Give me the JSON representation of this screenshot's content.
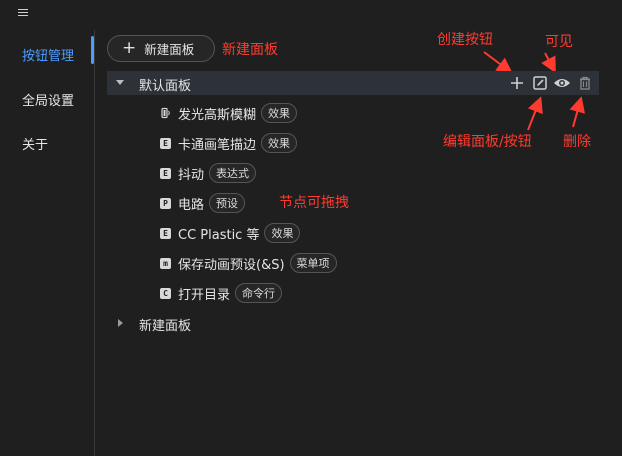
{
  "sidebar": {
    "items": [
      {
        "label": "按钮管理",
        "active": true
      },
      {
        "label": "全局设置",
        "active": false
      },
      {
        "label": "关于",
        "active": false
      }
    ]
  },
  "toolbar": {
    "new_panel_button": "新建面板"
  },
  "panels": [
    {
      "title": "默认面板",
      "expanded": true,
      "items": [
        {
          "icon": "battery-icon",
          "name": "发光高斯模糊",
          "tag": "效果"
        },
        {
          "icon": "E",
          "name": "卡通画笔描边",
          "tag": "效果"
        },
        {
          "icon": "E",
          "name": "抖动",
          "tag": "表达式"
        },
        {
          "icon": "P",
          "name": "电路",
          "tag": "预设"
        },
        {
          "icon": "E",
          "name": "CC Plastic 等",
          "tag": "效果"
        },
        {
          "icon": "m",
          "name": "保存动画预设(&S)",
          "tag": "菜单项"
        },
        {
          "icon": "C",
          "name": "打开目录",
          "tag": "命令行"
        }
      ]
    },
    {
      "title": "新建面板",
      "expanded": false,
      "items": []
    }
  ],
  "panel_actions": [
    "add-button-icon",
    "edit-icon",
    "eye-icon",
    "trash-icon"
  ],
  "annotations": {
    "new_panel": "新建面板",
    "create_button": "创建按钮",
    "visible": "可见",
    "edit": "编辑面板/按钮",
    "delete": "删除",
    "drag": "节点可拖拽"
  },
  "colors": {
    "accent": "#4d9cff",
    "annotation": "#ff3b30",
    "background": "#1f1f1f",
    "panel_header": "#2d3238"
  }
}
